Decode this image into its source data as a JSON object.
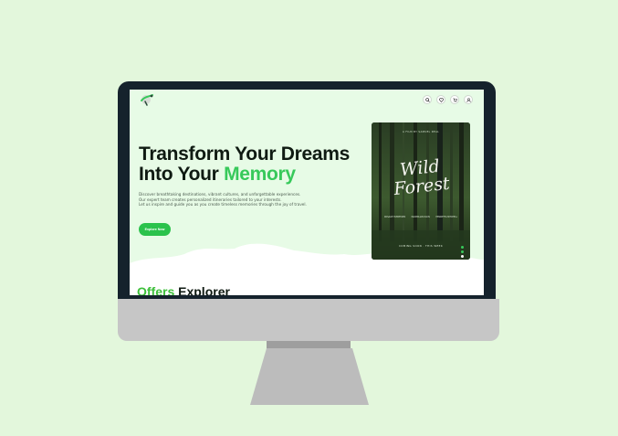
{
  "hero": {
    "title_line1": "Transform Your Dreams",
    "title_line2_prefix": "Into Your ",
    "title_line2_accent": "Memory",
    "description": [
      "Discover breathtaking destinations, vibrant cultures, and unforgettable experiences.",
      "Our expert team creates personalized itineraries tailored to your interests.",
      "Let us inspire and guide you as you create timeless memories through the joy of travel."
    ],
    "cta_label": "Explore Now"
  },
  "poster": {
    "top_line": "A FILM BY SAMUEL REAL",
    "title_line1": "Wild",
    "title_line2": "Forest",
    "credits": [
      "ROSALIE HUMPHRIES",
      "MAXIMILIAN DAVIS",
      "HENRIETTA MITCHELL"
    ],
    "bottom_line": "COMING SOON · THIS WEEK"
  },
  "section": {
    "title_accent": "Offers",
    "title_rest": " Explorer"
  },
  "nav": {
    "icons": [
      "search-icon",
      "heart-icon",
      "cart-icon",
      "user-icon"
    ]
  },
  "colors": {
    "accent": "#37c95a",
    "bezel": "#15222c",
    "screen_bg": "#e7fbe6",
    "page_bg": "#e3f7dc"
  }
}
